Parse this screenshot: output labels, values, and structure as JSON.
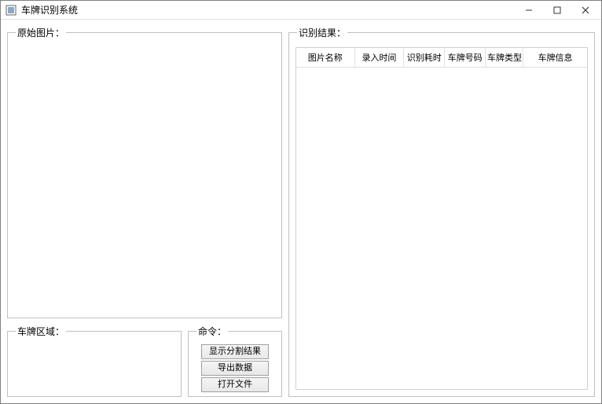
{
  "window": {
    "title": "车牌识别系统"
  },
  "panels": {
    "original_image_label": "原始图片：",
    "plate_area_label": "车牌区域：",
    "commands_label": "命令：",
    "results_label": "识别结果："
  },
  "commands": {
    "show_segmentation": "显示分割结果",
    "export_data": "导出数据",
    "open_file": "打开文件"
  },
  "results_table": {
    "columns": [
      "图片名称",
      "录入时间",
      "识别耗时",
      "车牌号码",
      "车牌类型",
      "车牌信息"
    ],
    "rows": []
  }
}
